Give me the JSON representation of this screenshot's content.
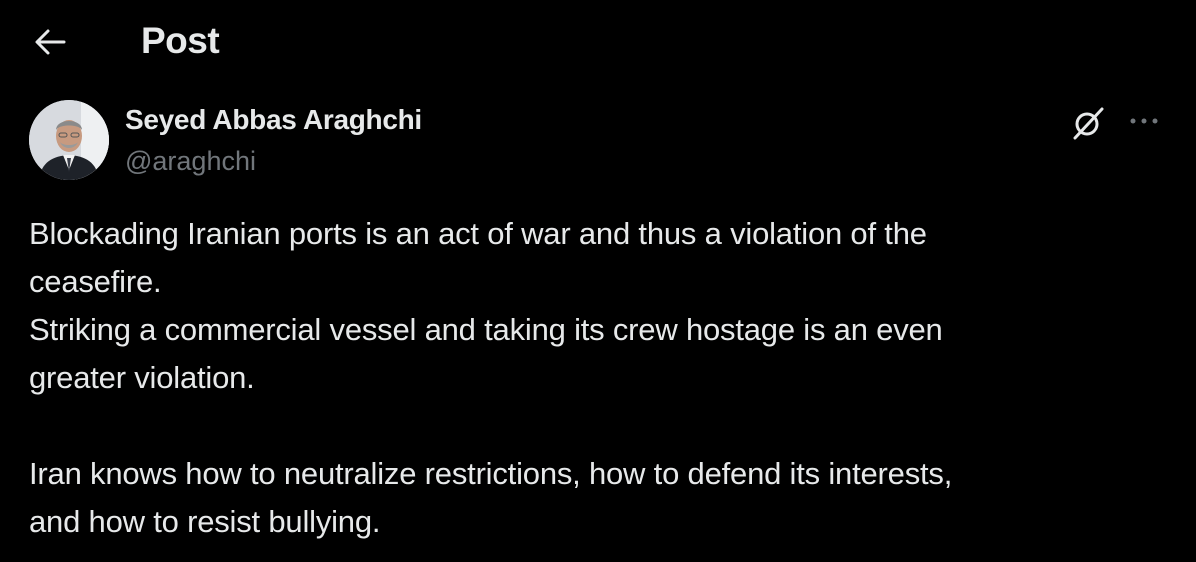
{
  "header": {
    "title": "Post"
  },
  "author": {
    "name": "Seyed Abbas Araghchi",
    "handle": "@araghchi"
  },
  "post": {
    "line1": "Blockading Iranian ports is an act of war and thus a violation of the",
    "line2": "ceasefire.",
    "line3": "Striking a commercial vessel and taking its crew hostage is an even",
    "line4": "greater violation.",
    "line5": "Iran knows how to neutralize restrictions, how to defend its interests,",
    "line6": "and how to resist bullying."
  },
  "colors": {
    "background": "#000000",
    "primary_text": "#e7e9ea",
    "secondary_text": "#71767b"
  },
  "icons": {
    "back": "arrow-left-icon",
    "grok": "grok-icon",
    "more": "more-dots-icon"
  }
}
